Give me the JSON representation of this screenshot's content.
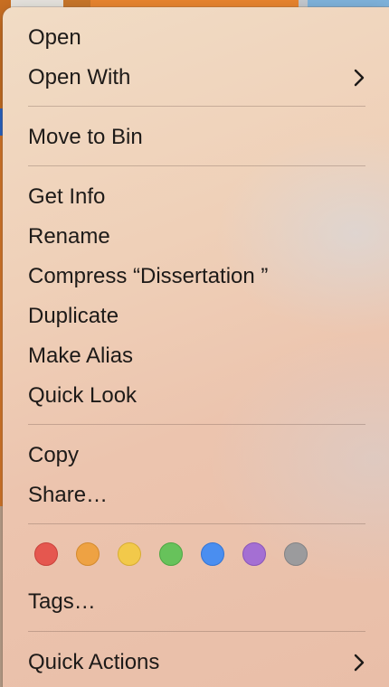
{
  "menu": {
    "items": [
      {
        "label": "Open"
      },
      {
        "label": "Open With",
        "submenu": true
      },
      {
        "label": "Move to Bin"
      },
      {
        "label": "Get Info"
      },
      {
        "label": "Rename"
      },
      {
        "label": "Compress “Dissertation ”"
      },
      {
        "label": "Duplicate"
      },
      {
        "label": "Make Alias"
      },
      {
        "label": "Quick Look"
      },
      {
        "label": "Copy"
      },
      {
        "label": "Share…"
      },
      {
        "label": "Tags…"
      },
      {
        "label": "Quick Actions",
        "submenu": true
      }
    ],
    "tag_colors": [
      {
        "name": "red",
        "fill": "#e5574f",
        "ring": "#c9423b"
      },
      {
        "name": "orange",
        "fill": "#eea243",
        "ring": "#d48a2d"
      },
      {
        "name": "yellow",
        "fill": "#f2c94a",
        "ring": "#d7ad33"
      },
      {
        "name": "green",
        "fill": "#67c25b",
        "ring": "#4ea744"
      },
      {
        "name": "blue",
        "fill": "#4a8ef0",
        "ring": "#3375d4"
      },
      {
        "name": "purple",
        "fill": "#a46fd3",
        "ring": "#8a56b8"
      },
      {
        "name": "gray",
        "fill": "#9b9b9d",
        "ring": "#828284"
      }
    ]
  }
}
